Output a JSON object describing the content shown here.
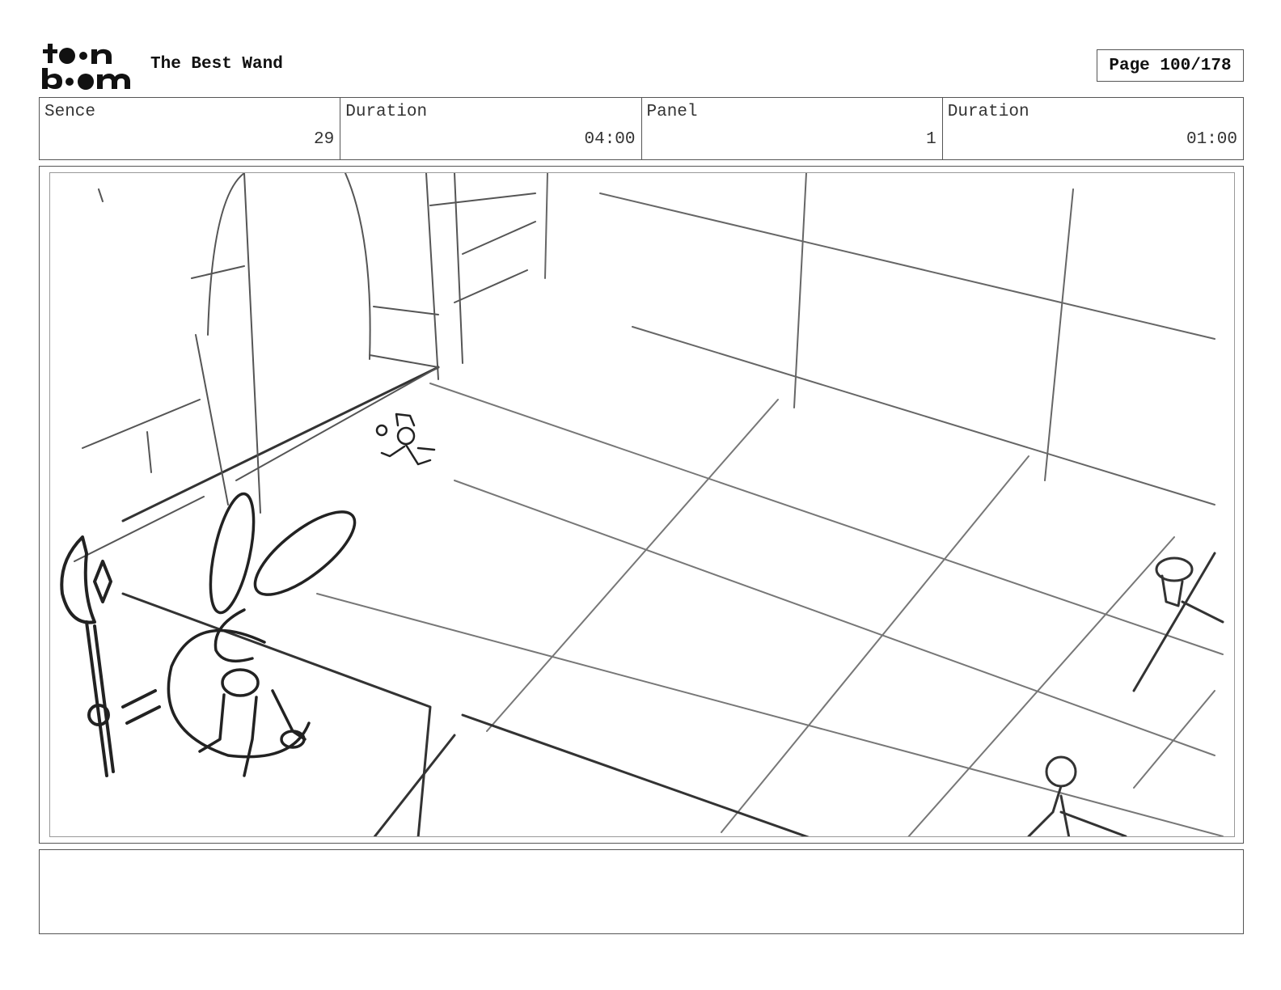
{
  "header": {
    "logo_text": "toon boom",
    "project_title": "The Best Wand",
    "page_label": "Page 100/178"
  },
  "info": {
    "scene_label": "Sence",
    "scene_value": "29",
    "scene_duration_label": "Duration",
    "scene_duration_value": "04:00",
    "panel_label": "Panel",
    "panel_value": "1",
    "panel_duration_label": "Duration",
    "panel_duration_value": "01:00"
  },
  "notes": {
    "text": ""
  }
}
